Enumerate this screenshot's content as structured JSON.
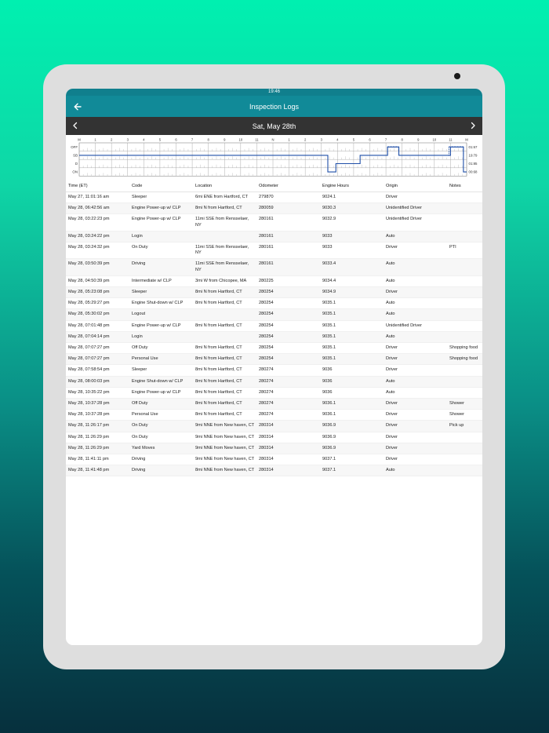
{
  "status": {
    "time": "19:46"
  },
  "header": {
    "title": "Inspection Logs",
    "back_icon": "arrow-left-icon"
  },
  "date_nav": {
    "date": "Sat, May 28th",
    "prev_icon": "chevron-left-icon",
    "next_icon": "chevron-right-icon"
  },
  "chart_data": {
    "type": "line",
    "title": "",
    "x_ticks": [
      "M",
      "1",
      "2",
      "3",
      "4",
      "5",
      "6",
      "7",
      "8",
      "9",
      "10",
      "11",
      "N",
      "1",
      "2",
      "3",
      "4",
      "5",
      "6",
      "7",
      "8",
      "9",
      "10",
      "11",
      "M"
    ],
    "rows": [
      "OFF",
      "SB",
      "D",
      "ON"
    ],
    "totals": [
      "01:67",
      "19:79",
      "01:85",
      "00:68"
    ],
    "xlim": [
      0,
      24
    ],
    "line_color": "#1f4fa8",
    "segments": [
      {
        "status": "SB",
        "start": 0.0,
        "end": 15.4
      },
      {
        "status": "ON",
        "start": 15.4,
        "end": 15.9
      },
      {
        "status": "D",
        "start": 15.9,
        "end": 17.4
      },
      {
        "status": "SB",
        "start": 17.4,
        "end": 19.1
      },
      {
        "status": "OFF",
        "start": 19.1,
        "end": 19.8
      },
      {
        "status": "SB",
        "start": 19.8,
        "end": 23.0
      },
      {
        "status": "OFF",
        "start": 23.0,
        "end": 23.8
      },
      {
        "status": "ON",
        "start": 23.8,
        "end": 24.0
      }
    ],
    "dashed_ranges": [
      [
        19.1,
        19.8
      ],
      [
        22.9,
        23.8
      ]
    ]
  },
  "table": {
    "headers": [
      "Time (ET)",
      "Code",
      "Location",
      "Odometer",
      "Engine Hours",
      "Origin",
      "Notes"
    ],
    "rows": [
      [
        "May 27, 11:01:16 am",
        "Sleeper",
        "6mi ENE from Hartford, CT",
        "279870",
        "9024.1",
        "Driver",
        ""
      ],
      [
        "May 28, 06:42:56 am",
        "Engine Power-up w/ CLP",
        "8mi N from Hartford, CT",
        "280059",
        "9030.3",
        "Unidentified Driver",
        ""
      ],
      [
        "May 28, 03:22:23 pm",
        "Engine Power-up w/ CLP",
        "11mi SSE from Rensselaer, NY",
        "280161",
        "9032.9",
        "Unidentified Driver",
        ""
      ],
      [
        "May 28, 03:24:22 pm",
        "Login",
        "",
        "280161",
        "9033",
        "Auto",
        ""
      ],
      [
        "May 28, 03:24:32 pm",
        "On Duty",
        "11mi SSE from Rensselaer, NY",
        "280161",
        "9033",
        "Driver",
        "PTI"
      ],
      [
        "May 28, 03:50:39 pm",
        "Driving",
        "11mi SSE from Rensselaer, NY",
        "280161",
        "9033.4",
        "Auto",
        ""
      ],
      [
        "May 28, 04:50:39 pm",
        "Intermediate w/ CLP",
        "3mi W from Chicopee, MA",
        "280225",
        "9034.4",
        "Auto",
        ""
      ],
      [
        "May 28, 05:23:08 pm",
        "Sleeper",
        "8mi N from Hartford, CT",
        "280254",
        "9034.9",
        "Driver",
        ""
      ],
      [
        "May 28, 05:29:27 pm",
        "Engine Shut-down w/ CLP",
        "8mi N from Hartford, CT",
        "280254",
        "9035.1",
        "Auto",
        ""
      ],
      [
        "May 28, 05:30:02 pm",
        "Logout",
        "",
        "280254",
        "9035.1",
        "Auto",
        ""
      ],
      [
        "May 28, 07:01:48 pm",
        "Engine Power-up w/ CLP",
        "8mi N from Hartford, CT",
        "280254",
        "9035.1",
        "Unidentified Driver",
        ""
      ],
      [
        "May 28, 07:04:14 pm",
        "Login",
        "",
        "280254",
        "9035.1",
        "Auto",
        ""
      ],
      [
        "May 28, 07:07:27 pm",
        "Off Duty",
        "8mi N from Hartford, CT",
        "280254",
        "9035.1",
        "Driver",
        "Shopping food"
      ],
      [
        "May 28, 07:07:27 pm",
        "Personal Use",
        "8mi N from Hartford, CT",
        "280254",
        "9035.1",
        "Driver",
        "Shopping food"
      ],
      [
        "May 28, 07:58:54 pm",
        "Sleeper",
        "8mi N from Hartford, CT",
        "280274",
        "9036",
        "Driver",
        ""
      ],
      [
        "May 28, 08:00:03 pm",
        "Engine Shut-down w/ CLP",
        "8mi N from Hartford, CT",
        "280274",
        "9036",
        "Auto",
        ""
      ],
      [
        "May 28, 10:35:22 pm",
        "Engine Power-up w/ CLP",
        "8mi N from Hartford, CT",
        "280274",
        "9036",
        "Auto",
        ""
      ],
      [
        "May 28, 10:37:28 pm",
        "Off Duty",
        "8mi N from Hartford, CT",
        "280274",
        "9036.1",
        "Driver",
        "Shower"
      ],
      [
        "May 28, 10:37:28 pm",
        "Personal Use",
        "8mi N from Hartford, CT",
        "280274",
        "9036.1",
        "Driver",
        "Shower"
      ],
      [
        "May 28, 11:26:17 pm",
        "On Duty",
        "9mi NNE from New haven, CT",
        "280314",
        "9036.9",
        "Driver",
        "Pick up"
      ],
      [
        "May 28, 11:26:29 pm",
        "On Duty",
        "9mi NNE from New haven, CT",
        "280314",
        "9036.9",
        "Driver",
        ""
      ],
      [
        "May 28, 11:26:29 pm",
        "Yard Moves",
        "9mi NNE from New haven, CT",
        "280314",
        "9036.9",
        "Driver",
        ""
      ],
      [
        "May 28, 11:41:11 pm",
        "Driving",
        "9mi NNE from New haven, CT",
        "280314",
        "9037.1",
        "Driver",
        ""
      ],
      [
        "May 28, 11:41:48 pm",
        "Driving",
        "8mi NNE from New haven, CT",
        "280314",
        "9037.1",
        "Auto",
        ""
      ]
    ]
  }
}
